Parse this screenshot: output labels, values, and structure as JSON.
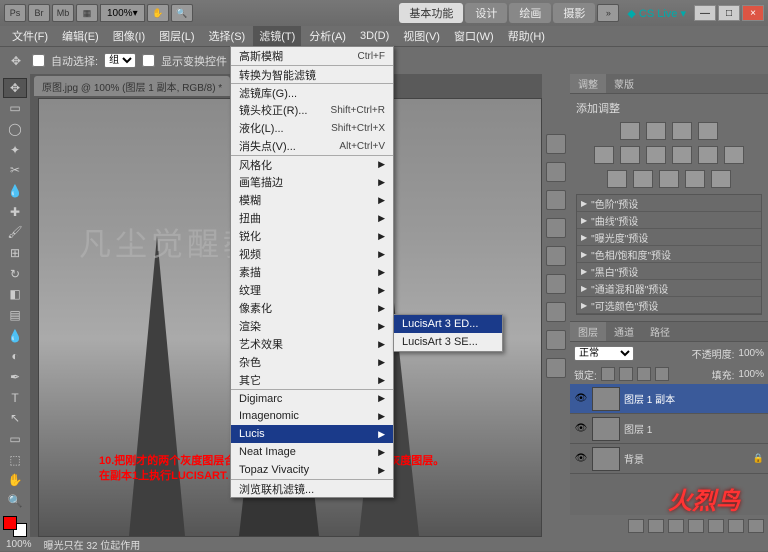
{
  "titlebar": {
    "ps": "Ps",
    "br": "Br",
    "mb": "Mb",
    "zoom": "100%",
    "tabs": {
      "basic": "基本功能",
      "design": "设计",
      "draw": "绘画",
      "photo": "摄影"
    },
    "cslive": "CS Live",
    "min": "—",
    "max": "□",
    "close": "×"
  },
  "menubar": {
    "file": "文件(F)",
    "edit": "编辑(E)",
    "image": "图像(I)",
    "layer": "图层(L)",
    "select": "选择(S)",
    "filter": "滤镜(T)",
    "analysis": "分析(A)",
    "t3d": "3D(D)",
    "view": "视图(V)",
    "window": "窗口(W)",
    "help": "帮助(H)"
  },
  "optbar": {
    "autosel_lbl": "自动选择:",
    "group": "组",
    "transform_lbl": "显示变换控件"
  },
  "doc_tab": "原图.jpg @ 100% (图层 1 副本, RGB/8) *",
  "watermark": "凡尘觉醒教程",
  "redtext": {
    "l1": "10.把刚才的两个灰度图层合并在一起，然后再次复制出一个灰度图层。",
    "l2": "在副本1上执行LUCISART."
  },
  "filter_menu": {
    "gauss": "高斯模糊",
    "gauss_sc": "Ctrl+F",
    "smart": "转换为智能滤镜",
    "lib": "滤镜库(G)...",
    "lens": "镜头校正(R)...",
    "lens_sc": "Shift+Ctrl+R",
    "liquify": "液化(L)...",
    "liquify_sc": "Shift+Ctrl+X",
    "vanish": "消失点(V)...",
    "vanish_sc": "Alt+Ctrl+V",
    "stylize": "风格化",
    "brush": "画笔描边",
    "blur": "模糊",
    "distort": "扭曲",
    "sharpen": "锐化",
    "video": "视频",
    "sketch": "素描",
    "texture": "纹理",
    "pixelate": "像素化",
    "render": "渲染",
    "artistic": "艺术效果",
    "noise": "杂色",
    "other": "其它",
    "digimarc": "Digimarc",
    "imagenomic": "Imagenomic",
    "lucis": "Lucis",
    "neat": "Neat Image",
    "topaz": "Topaz Vivacity",
    "browse": "浏览联机滤镜..."
  },
  "lucis_sub": {
    "ed": "LucisArt 3 ED...",
    "se": "LucisArt 3 SE..."
  },
  "panels": {
    "adj_tab": "调整",
    "mask_tab": "蒙版",
    "adj_title": "添加调整",
    "presets": {
      "levels": "\"色阶\"预设",
      "curves": "\"曲线\"预设",
      "exposure": "\"曝光度\"预设",
      "hue": "\"色相/饱和度\"预设",
      "bw": "\"黑白\"预设",
      "mixer": "\"通道混和器\"预设",
      "selcolor": "\"可选颜色\"预设"
    },
    "layers_tab": "图层",
    "channels_tab": "通道",
    "paths_tab": "路径",
    "blend": "正常",
    "opacity_lbl": "不透明度:",
    "opacity_val": "100%",
    "lock_lbl": "锁定:",
    "fill_lbl": "填充:",
    "fill_val": "100%",
    "layer1copy": "图层 1 副本",
    "layer1": "图层 1",
    "bg_layer": "背景"
  },
  "statusbar": {
    "zoom": "100%",
    "info": "曝光只在 32 位起作用"
  },
  "fire": "火烈鸟"
}
